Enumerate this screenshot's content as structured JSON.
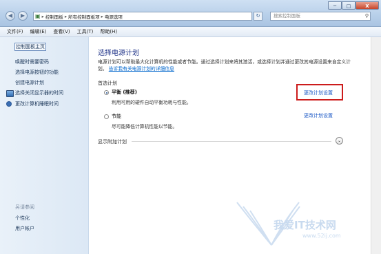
{
  "window": {
    "breadcrumbs": [
      "控制面板",
      "所有控制面板项",
      "电源选项"
    ],
    "search_placeholder": "搜索控制面板",
    "controls": {
      "minimize": "─",
      "maximize": "□",
      "close": "X"
    }
  },
  "menu": [
    {
      "label": "文件(F)"
    },
    {
      "label": "编辑(E)"
    },
    {
      "label": "查看(V)"
    },
    {
      "label": "工具(T)"
    },
    {
      "label": "帮助(H)"
    }
  ],
  "sidebar": {
    "home": "控制面板主页",
    "links": [
      "唤醒时需要密码",
      "选择电源按钮的功能",
      "创建电源计划",
      "选择关闭显示器的时间",
      "更改计算机睡眠时间"
    ],
    "see_also_heading": "另请参阅",
    "see_also": [
      "个性化",
      "用户帐户"
    ]
  },
  "main": {
    "title": "选择电源计划",
    "description": "电源计划可以帮助最大化计算机的性能或者节能。通过选择计划来将其激活，或选择计划并通过更改其电源设置来自定义计划。",
    "description_link": "告诉我有关电源计划的详细信息",
    "section": "首选计划",
    "plans": [
      {
        "name": "平衡 (推荐)",
        "desc": "利用可用的硬件自动平衡功耗与性能。",
        "selected": true,
        "link": "更改计划设置"
      },
      {
        "name": "节能",
        "desc": "尽可能降低计算机性能以节能。",
        "selected": false,
        "link": "更改计划设置"
      }
    ],
    "extra_plans": "显示附加计划"
  },
  "watermark": {
    "text": "我爱IT技术网",
    "url": "www.52ij.com"
  },
  "colors": {
    "highlight_box": "#cc1b1b",
    "link": "#1c59c6",
    "title": "#1e3287"
  }
}
